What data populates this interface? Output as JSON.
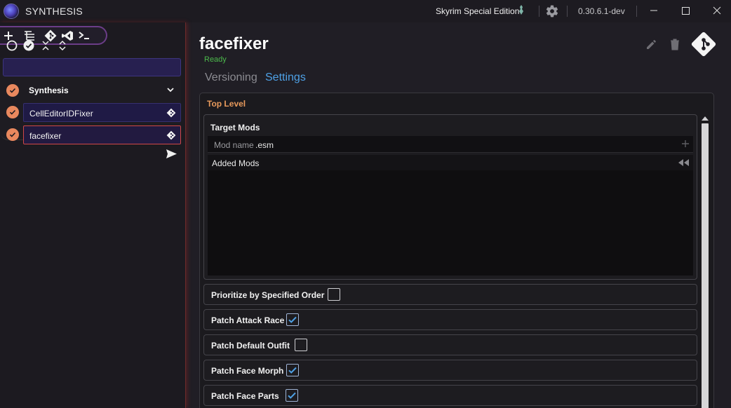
{
  "window": {
    "app_title": "SYNTHESIS",
    "game": "Skyrim Special Edition",
    "version": "0.30.6.1-dev"
  },
  "icons": {
    "toolbar": [
      "plus-icon",
      "list-tree-icon",
      "git-icon",
      "visual-studio-icon",
      "terminal-icon"
    ],
    "selection": [
      "circle-outline-icon",
      "check-circle-icon",
      "collapse-icon",
      "expand-icon"
    ]
  },
  "sidebar": {
    "group": {
      "label": "Synthesis"
    },
    "patchers": [
      {
        "label": "CellEditorIDFixer"
      },
      {
        "label": "facefixer"
      }
    ]
  },
  "main": {
    "title": "facefixer",
    "status": "Ready",
    "tabs": [
      {
        "label": "Versioning",
        "active": false
      },
      {
        "label": "Settings",
        "active": true
      }
    ]
  },
  "settings": {
    "section": "Top Level",
    "target_mods": {
      "label": "Target Mods",
      "placeholder": "Mod name",
      "extension": ".esm",
      "added_label": "Added Mods"
    },
    "toggles": [
      {
        "label": "Prioritize by Specified Order",
        "checked": false
      },
      {
        "label": "Patch Attack Race",
        "checked": true
      },
      {
        "label": "Patch Default Outfit",
        "checked": false
      },
      {
        "label": "Patch Face Morph",
        "checked": true
      },
      {
        "label": "Patch Face Parts",
        "checked": true
      }
    ]
  },
  "colors": {
    "accent": "#4ea1e6",
    "section": "#e89a5c",
    "status_ok": "#4cba4c",
    "patcher_check": "#e9885e",
    "selected_border": "#d04848"
  }
}
